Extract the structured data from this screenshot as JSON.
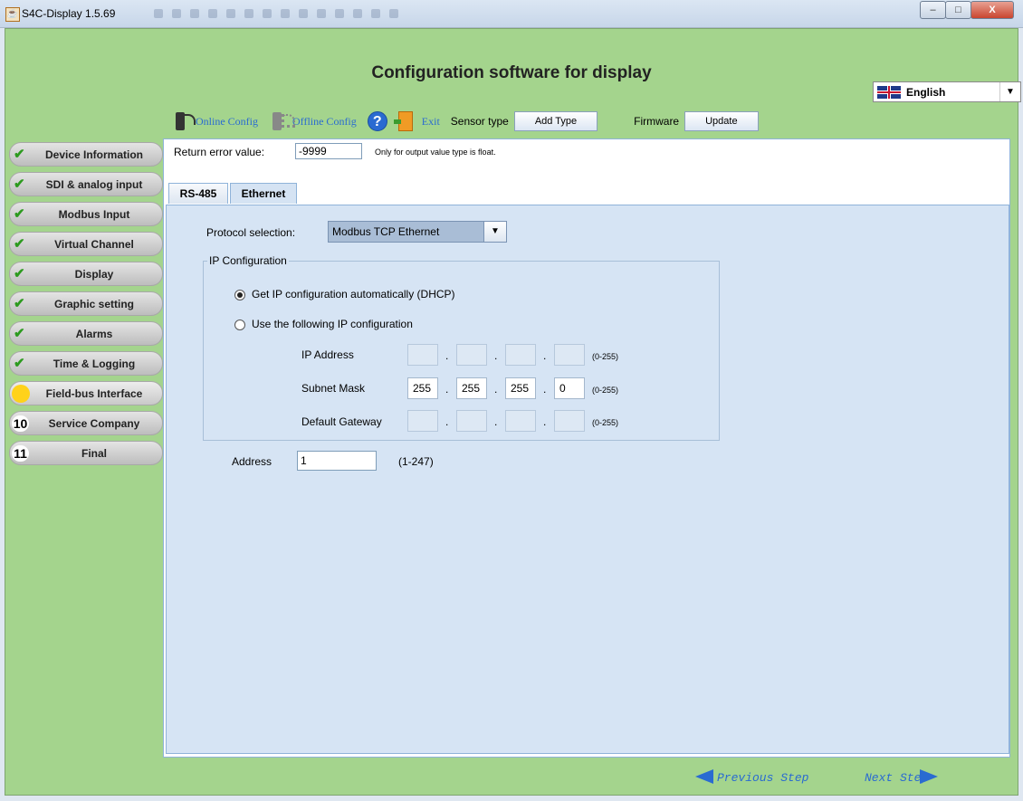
{
  "window": {
    "title": "S4C-Display 1.5.69",
    "icon": "java-cup-icon",
    "controls": {
      "minimize": "–",
      "maximize": "□",
      "close": "X"
    }
  },
  "header": {
    "title": "Configuration software for display"
  },
  "language": {
    "selected": "English",
    "flag": "uk-flag-icon"
  },
  "toolbar": {
    "online_config": "Online Config",
    "offline_config": "Offline Config",
    "help_symbol": "?",
    "exit": "Exit",
    "sensor_type_label": "Sensor type",
    "add_type_button": "Add Type",
    "firmware_label": "Firmware",
    "update_button": "Update"
  },
  "sidebar": {
    "items": [
      {
        "label": "Device Information",
        "status": "done"
      },
      {
        "label": "SDI & analog input",
        "status": "done"
      },
      {
        "label": "Modbus Input",
        "status": "done"
      },
      {
        "label": "Virtual Channel",
        "status": "done"
      },
      {
        "label": "Display",
        "status": "done"
      },
      {
        "label": "Graphic setting",
        "status": "done"
      },
      {
        "label": "Alarms",
        "status": "done"
      },
      {
        "label": "Time & Logging",
        "status": "done"
      },
      {
        "label": "Field-bus Interface",
        "status": "current"
      },
      {
        "label": "Service Company",
        "status": "pending",
        "number": "10"
      },
      {
        "label": "Final",
        "status": "pending",
        "number": "11"
      }
    ]
  },
  "content": {
    "return_error_label": "Return error value:",
    "return_error_value": "-9999",
    "return_error_note": "Only for output value type is float.",
    "tabs": [
      {
        "label": "RS-485"
      },
      {
        "label": "Ethernet",
        "selected": true
      }
    ],
    "protocol_label": "Protocol selection:",
    "protocol_value": "Modbus TCP Ethernet",
    "ip_config": {
      "legend": "IP Configuration",
      "option_dhcp": "Get IP configuration automatically (DHCP)",
      "option_static": "Use the following IP configuration",
      "selected": "dhcp",
      "ip_address_label": "IP Address",
      "ip_address": [
        "",
        "",
        "",
        ""
      ],
      "subnet_mask_label": "Subnet Mask",
      "subnet_mask": [
        "255",
        "255",
        "255",
        "0"
      ],
      "gateway_label": "Default Gateway",
      "gateway": [
        "",
        "",
        "",
        ""
      ],
      "range_hint": "(0-255)",
      "separator": "."
    },
    "address_label": "Address",
    "address_value": "1",
    "address_range": "(1-247)"
  },
  "footer": {
    "previous_step": "Previous Step",
    "next_step": "Next Step"
  },
  "colors": {
    "app_background": "#a4d48d",
    "link_blue": "#2a6bd1",
    "current_step": "#ffd21a",
    "done_check": "#2c9a1e"
  }
}
